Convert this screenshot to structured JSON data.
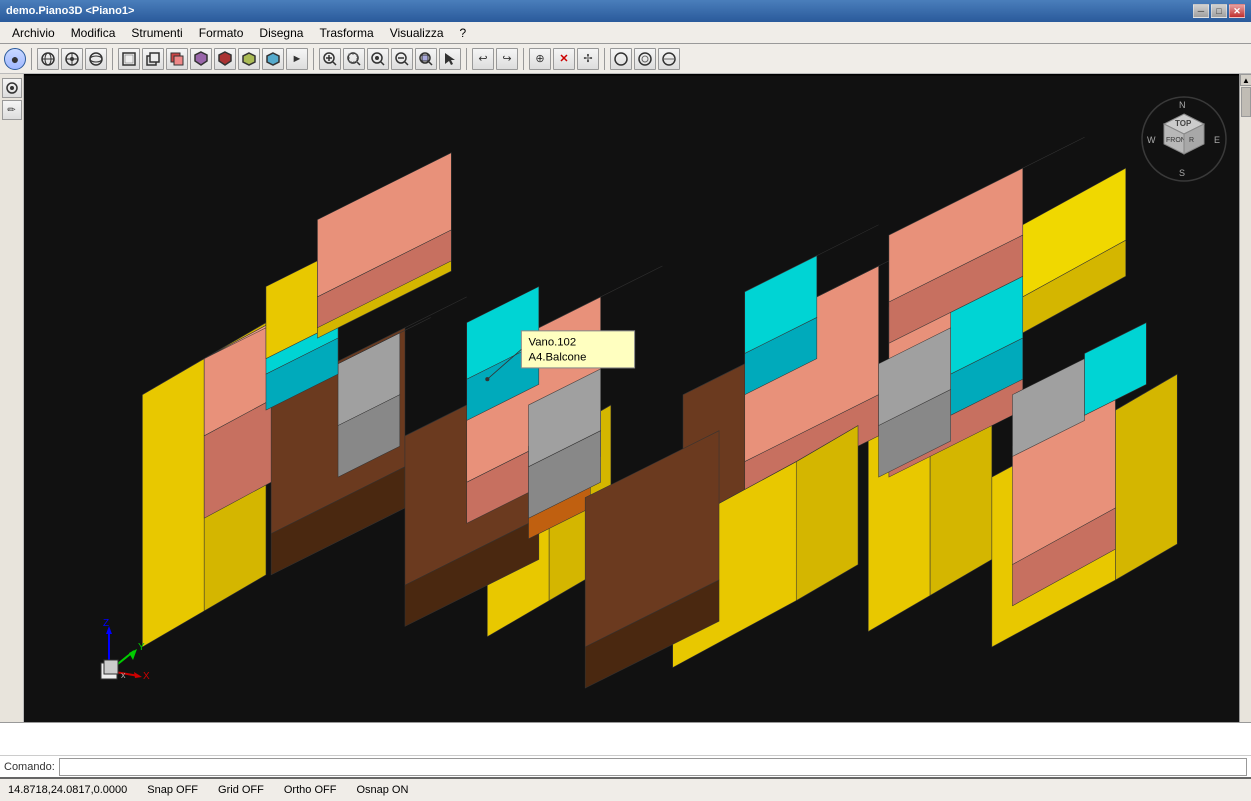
{
  "title": "demo.Piano3D <Piano1>",
  "menu": {
    "items": [
      "Archivio",
      "Modifica",
      "Strumenti",
      "Formato",
      "Disegna",
      "Trasforma",
      "Visualizza",
      "?"
    ]
  },
  "toolbar": {
    "buttons": [
      {
        "name": "record",
        "icon": "⏺",
        "title": "Record"
      },
      {
        "name": "orbit",
        "icon": "🌐",
        "title": "Orbit"
      },
      {
        "name": "pan",
        "icon": "✋",
        "title": "Pan"
      },
      {
        "name": "view1",
        "icon": "◻",
        "title": "View1"
      },
      {
        "name": "view2",
        "icon": "◼",
        "title": "View2"
      },
      {
        "name": "front",
        "icon": "⬜",
        "title": "Front"
      },
      {
        "name": "back",
        "icon": "⬛",
        "title": "Back"
      },
      {
        "name": "left",
        "icon": "◧",
        "title": "Left"
      },
      {
        "name": "right",
        "icon": "◨",
        "title": "Right"
      },
      {
        "name": "top",
        "icon": "⬜",
        "title": "Top"
      },
      {
        "name": "bottom",
        "icon": "⬛",
        "title": "Bottom"
      },
      {
        "name": "iso",
        "icon": "◈",
        "title": "Isometric"
      },
      {
        "name": "zoom-extent",
        "icon": "⊞",
        "title": "Zoom Extent"
      },
      {
        "name": "zoom-in",
        "icon": "⊕",
        "title": "Zoom In"
      },
      {
        "name": "zoom-window",
        "icon": "🔍",
        "title": "Zoom Window"
      },
      {
        "name": "zoom-out",
        "icon": "⊖",
        "title": "Zoom Out"
      },
      {
        "name": "zoom-obj",
        "icon": "⊙",
        "title": "Zoom Object"
      },
      {
        "name": "select",
        "icon": "⟐",
        "title": "Select"
      },
      {
        "name": "undo",
        "icon": "↩",
        "title": "Undo"
      },
      {
        "name": "redo",
        "icon": "↪",
        "title": "Redo"
      },
      {
        "name": "snap",
        "icon": "⊕",
        "title": "Snap"
      },
      {
        "name": "delete",
        "icon": "✕",
        "title": "Delete"
      },
      {
        "name": "move",
        "icon": "✢",
        "title": "Move"
      },
      {
        "name": "orbit2",
        "icon": "⊙",
        "title": "Orbit"
      },
      {
        "name": "circle1",
        "icon": "○",
        "title": "Circle"
      },
      {
        "name": "circle2",
        "icon": "○",
        "title": "Circle2"
      },
      {
        "name": "circle3",
        "icon": "○",
        "title": "Circle3"
      }
    ]
  },
  "left_toolbar": {
    "buttons": [
      {
        "name": "snap-toggle",
        "icon": "◎"
      },
      {
        "name": "draw-tool",
        "icon": "✏"
      }
    ]
  },
  "tooltip": {
    "line1": "Vano.102",
    "line2": "A4.Balcone"
  },
  "nav_cube": {
    "top_label": "TOP",
    "front_label": "FRONT",
    "right_label": "E",
    "left_label": "W",
    "bottom_label": "S"
  },
  "status_bar": {
    "coords": "14.8718,24.0817,0.0000",
    "snap": "Snap OFF",
    "grid": "Grid OFF",
    "ortho": "Ortho OFF",
    "osnap": "Osnap ON"
  },
  "command": {
    "label": "Comando:",
    "placeholder": ""
  },
  "scrollbar": {
    "up_arrow": "▲",
    "down_arrow": "▼",
    "left_arrow": "◄",
    "right_arrow": "►"
  }
}
